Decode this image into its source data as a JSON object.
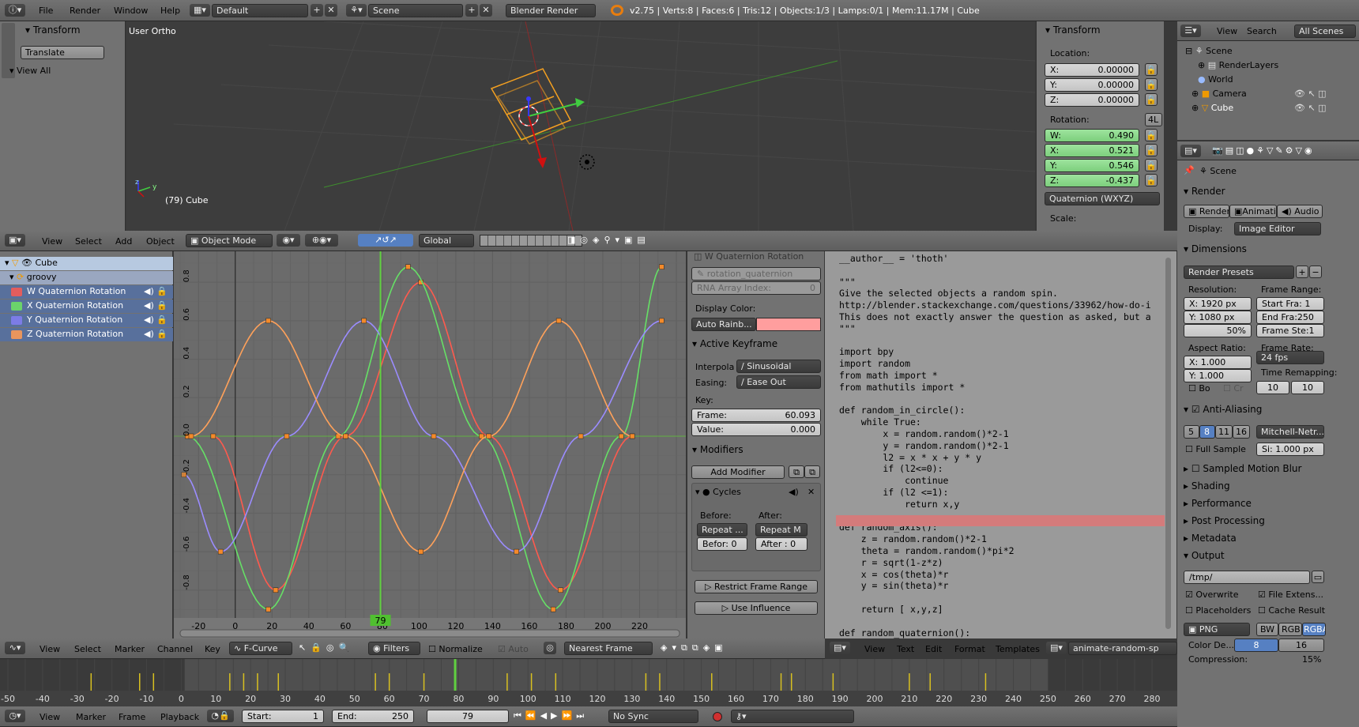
{
  "info_header": {
    "menus": [
      "File",
      "Render",
      "Window",
      "Help"
    ],
    "layout": "Default",
    "scene": "Scene",
    "engine": "Blender Render",
    "stats": "v2.75 | Verts:8 | Faces:6 | Tris:12 | Objects:1/3 | Lamps:0/1 | Mem:11.17M | Cube"
  },
  "tool_shelf": {
    "transform_title": "Transform",
    "translate": "Translate",
    "view_all": "View All"
  },
  "viewport": {
    "label": "User Ortho",
    "object_label": "(79) Cube",
    "menus": [
      "View",
      "Select",
      "Add",
      "Object"
    ],
    "mode": "Object Mode",
    "orientation": "Global",
    "axis_z": "z",
    "axis_y": "y"
  },
  "n_panel": {
    "title": "Transform",
    "location_label": "Location:",
    "location": [
      {
        "axis": "X:",
        "value": "0.00000"
      },
      {
        "axis": "Y:",
        "value": "0.00000"
      },
      {
        "axis": "Z:",
        "value": "0.00000"
      }
    ],
    "rotation_label": "Rotation:",
    "lock_4l": "4L",
    "rotation": [
      {
        "axis": "W:",
        "value": "0.490"
      },
      {
        "axis": "X:",
        "value": "0.521"
      },
      {
        "axis": "Y:",
        "value": "0.546"
      },
      {
        "axis": "Z:",
        "value": "-0.437"
      }
    ],
    "rotation_mode": "Quaternion (WXYZ)",
    "scale_label": "Scale:"
  },
  "outliner": {
    "menus": [
      "View",
      "Search"
    ],
    "filter": "All Scenes",
    "items": [
      {
        "label": "Scene"
      },
      {
        "label": "RenderLayers"
      },
      {
        "label": "World"
      },
      {
        "label": "Camera"
      },
      {
        "label": "Cube"
      }
    ]
  },
  "properties": {
    "context": "Scene",
    "render_title": "Render",
    "render_btns": [
      "Render",
      "Animatio",
      "Audio"
    ],
    "display_label": "Display:",
    "display": "Image Editor",
    "dimensions_title": "Dimensions",
    "presets": "Render Presets",
    "resolution_label": "Resolution:",
    "res_x": "X:  1920 px",
    "res_y": "Y:  1080 px",
    "res_pct": "50%",
    "frame_range_label": "Frame Range:",
    "start_fra": "Start Fra:  1",
    "end_fra": "End Fra:250",
    "frame_step": "Frame Ste:1",
    "aspect_label": "Aspect Ratio:",
    "asp_x": "X:    1.000",
    "asp_y": "Y:    1.000",
    "frame_rate_label": "Frame Rate:",
    "fps": "24 fps",
    "remap_label": "Time Remapping:",
    "remap_old": "10",
    "remap_new": "10",
    "bo": "Bo",
    "cr": "Cr",
    "aa_title": "Anti-Aliasing",
    "aa_samples": [
      "5",
      "8",
      "11",
      "16"
    ],
    "aa_filter": "Mitchell-Netr...",
    "full_sample": "Full Sample",
    "si": "Si: 1.000 px",
    "motion_blur": "Sampled Motion Blur",
    "shading": "Shading",
    "performance": "Performance",
    "post": "Post Processing",
    "metadata": "Metadata",
    "output": "Output",
    "path": "/tmp/",
    "overwrite": "Overwrite",
    "file_ext": "File Extens...",
    "placeholders": "Placeholders",
    "cache": "Cache Result",
    "format": "PNG",
    "color_modes": [
      "BW",
      "RGB",
      "RGBA"
    ],
    "color_depth_label": "Color De...",
    "depths": [
      "8",
      "16"
    ],
    "compression_label": "Compression:",
    "compression": "15%"
  },
  "channels": [
    {
      "name": "Cube"
    },
    {
      "name": "groovy"
    },
    {
      "name": "W Quaternion Rotation",
      "color": "#e35d5d"
    },
    {
      "name": "X Quaternion Rotation",
      "color": "#6bd36b"
    },
    {
      "name": "Y Quaternion Rotation",
      "color": "#7c7ce6"
    },
    {
      "name": "Z Quaternion Rotation",
      "color": "#e8955d"
    }
  ],
  "chart_data": {
    "type": "line",
    "title": "",
    "xlabel": "",
    "ylabel": "",
    "xlim": [
      -30,
      240
    ],
    "ylim": [
      -0.92,
      0.92
    ],
    "x_ticks": [
      "-20",
      "0",
      "20",
      "40",
      "60",
      "80",
      "100",
      "120",
      "140",
      "160",
      "180",
      "200",
      "220"
    ],
    "y_ticks": [
      "0.8",
      "0.6",
      "0.4",
      "0.2",
      "0.0",
      "-0.2",
      "-0.4",
      "-0.6",
      "-0.8"
    ],
    "current_frame": "79",
    "series": [
      {
        "name": "W Quaternion Rotation",
        "color": "#ff5a4e",
        "keys": [
          [
            -12,
            0
          ],
          [
            22,
            -0.8
          ],
          [
            60,
            0
          ],
          [
            101,
            0.8
          ],
          [
            138,
            0
          ],
          [
            177,
            -0.8
          ],
          [
            216,
            0
          ]
        ]
      },
      {
        "name": "X Quaternion Rotation",
        "color": "#66e066",
        "keys": [
          [
            -26,
            0
          ],
          [
            18,
            -0.9
          ],
          [
            56,
            0
          ],
          [
            94,
            0.88
          ],
          [
            134,
            0
          ],
          [
            173,
            -0.9
          ],
          [
            210,
            0
          ],
          [
            232,
            0.88
          ]
        ]
      },
      {
        "name": "Y Quaternion Rotation",
        "color": "#9b8cff",
        "keys": [
          [
            -28,
            -0.2
          ],
          [
            -8,
            -0.6
          ],
          [
            28,
            0
          ],
          [
            70,
            0.6
          ],
          [
            108,
            0
          ],
          [
            153,
            -0.6
          ],
          [
            188,
            0
          ],
          [
            232,
            0.6
          ]
        ]
      },
      {
        "name": "Z Quaternion Rotation",
        "color": "#ffa15a",
        "keys": [
          [
            -24,
            0
          ],
          [
            18,
            0.6
          ],
          [
            60,
            0
          ],
          [
            101,
            -0.6
          ],
          [
            138,
            0
          ],
          [
            176,
            0.6
          ],
          [
            216,
            0
          ]
        ]
      }
    ]
  },
  "graph_header": {
    "menus": [
      "View",
      "Select",
      "Marker",
      "Channel",
      "Key"
    ],
    "mode": "F-Curve",
    "filters": "Filters",
    "normalize": "Normalize",
    "auto": "Auto",
    "snap": "Nearest Frame"
  },
  "fcurve_panel": {
    "channel": "W Quaternion Rotation",
    "path": "rotation_quaternion",
    "rna_index": "RNA Array Index:",
    "rna_value": "0",
    "display_color_label": "Display Color:",
    "display_color": "Auto Rainb...",
    "active_kf": "Active Keyframe",
    "interp_label": "Interpola",
    "interp": "Sinusoidal",
    "easing_label": "Easing:",
    "easing": "Ease Out",
    "key_label": "Key:",
    "frame_label": "Frame:",
    "frame_value": "60.093",
    "value_label": "Value:",
    "value_value": "0.000",
    "modifiers": "Modifiers",
    "add_modifier": "Add Modifier",
    "cycles": "Cycles",
    "before_label": "Before:",
    "after_label": "After:",
    "before_mode": "Repeat ...",
    "after_mode": "Repeat M",
    "before_count": "Befor:  0",
    "after_count": "After :  0",
    "restrict": "Restrict Frame Range",
    "influence": "Use Influence"
  },
  "text_editor": {
    "menus": [
      "View",
      "Text",
      "Edit",
      "Format",
      "Templates"
    ],
    "filename": "animate-random-sp",
    "lines": [
      "__author__ = 'thoth'",
      "",
      "\"\"\"",
      "Give the selected objects a random spin.",
      "http://blender.stackexchange.com/questions/33962/how-do-i",
      "This does not exactly answer the question as asked, but a",
      "\"\"\"",
      "",
      "import bpy",
      "import random",
      "from math import *",
      "from mathutils import *",
      "",
      "def random_in_circle():",
      "    while True:",
      "        x = random.random()*2-1",
      "        y = random.random()*2-1",
      "        l2 = x * x + y * y",
      "        if (l2<=0):",
      "            continue",
      "        if (l2 <=1):",
      "            return x,y",
      "",
      "def random_axis():",
      "    z = random.random()*2-1",
      "    theta = random.random()*pi*2",
      "    r = sqrt(1-z*z)",
      "    x = cos(theta)*r",
      "    y = sin(theta)*r",
      "",
      "    return [ x,y,z]",
      "",
      "def random_quaternion():"
    ]
  },
  "timeline": {
    "ticks": [
      "-50",
      "-40",
      "-30",
      "-20",
      "-10",
      "0",
      "10",
      "20",
      "30",
      "40",
      "50",
      "60",
      "70",
      "80",
      "90",
      "100",
      "110",
      "120",
      "130",
      "140",
      "150",
      "160",
      "170",
      "180",
      "190",
      "200",
      "210",
      "220",
      "230",
      "240",
      "250",
      "260",
      "270",
      "280"
    ],
    "menus": [
      "View",
      "Marker",
      "Frame",
      "Playback"
    ],
    "start": "Start:",
    "start_val": "1",
    "end": "End:",
    "end_val": "250",
    "current": "79",
    "sync": "No Sync"
  }
}
